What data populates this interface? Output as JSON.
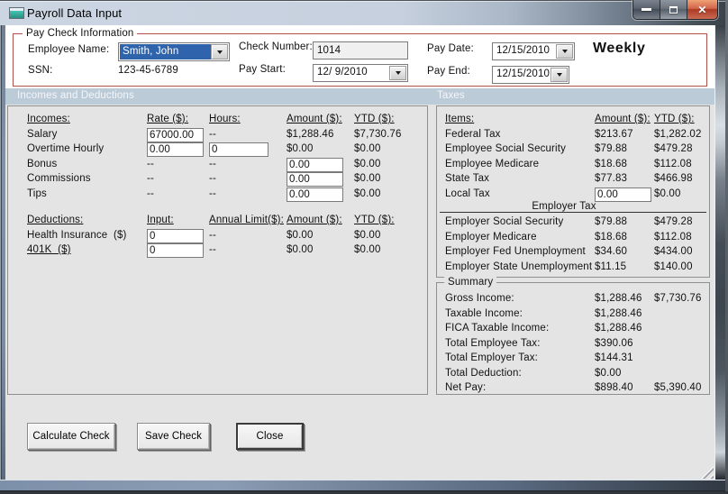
{
  "window": {
    "title": "Payroll Data Input"
  },
  "paycheck": {
    "legend": "Pay Check Information",
    "employee_name": {
      "label": "Employee Name:",
      "value": "Smith, John"
    },
    "ssn": {
      "label": "SSN:",
      "value": "123-45-6789"
    },
    "check_number": {
      "label": "Check Number:",
      "value": "1014"
    },
    "pay_start": {
      "label": "Pay Start:",
      "value": "12/ 9/2010"
    },
    "pay_date": {
      "label": "Pay Date:",
      "value": "12/15/2010"
    },
    "pay_end": {
      "label": "Pay End:",
      "value": "12/15/2010"
    },
    "frequency": "Weekly"
  },
  "section_headers": {
    "left": "Incomes and Deductions",
    "right": "Taxes"
  },
  "incomes": {
    "headers": {
      "item": "Incomes:",
      "rate": "Rate ($):",
      "hours": "Hours:",
      "amount": "Amount ($):",
      "ytd": "YTD ($):"
    },
    "rows": [
      {
        "label": "Salary",
        "rate": "67000.00",
        "hours": "--",
        "amount": "$1,288.46",
        "ytd": "$7,730.76"
      },
      {
        "label": "Overtime Hourly",
        "rate": "0.00",
        "hours": "0",
        "amount": "$0.00",
        "ytd": "$0.00"
      },
      {
        "label": "Bonus",
        "rate": "--",
        "hours": "--",
        "amount": "0.00",
        "ytd": "$0.00"
      },
      {
        "label": "Commissions",
        "rate": "--",
        "hours": "--",
        "amount": "0.00",
        "ytd": "$0.00"
      },
      {
        "label": "Tips",
        "rate": "--",
        "hours": "--",
        "amount": "0.00",
        "ytd": "$0.00"
      }
    ]
  },
  "deductions": {
    "headers": {
      "item": "Deductions:",
      "input": "Input:",
      "annual_limit": "Annual Limit($):",
      "amount": "Amount ($):",
      "ytd": "YTD ($):"
    },
    "rows": [
      {
        "label": "Health Insurance  ($)",
        "input": "0",
        "annual_limit": "--",
        "amount": "$0.00",
        "ytd": "$0.00"
      },
      {
        "label": "401K  ($)",
        "input": "0",
        "annual_limit": "--",
        "amount": "$0.00",
        "ytd": "$0.00"
      }
    ]
  },
  "taxes": {
    "headers": {
      "item": "Items:",
      "amount": "Amount ($):",
      "ytd": "YTD ($):"
    },
    "employee_rows": [
      {
        "label": "Federal Tax",
        "amount": "$213.67",
        "ytd": "$1,282.02"
      },
      {
        "label": "Employee Social Security",
        "amount": "$79.88",
        "ytd": "$479.28"
      },
      {
        "label": "Employee Medicare",
        "amount": "$18.68",
        "ytd": "$112.08"
      },
      {
        "label": "State Tax",
        "amount": "$77.83",
        "ytd": "$466.98"
      },
      {
        "label": "Local Tax",
        "amount": "0.00",
        "ytd": "$0.00"
      }
    ],
    "employer_caption": "Employer Tax",
    "employer_rows": [
      {
        "label": "Employer Social Security",
        "amount": "$79.88",
        "ytd": "$479.28"
      },
      {
        "label": "Employer Medicare",
        "amount": "$18.68",
        "ytd": "$112.08"
      },
      {
        "label": "Employer Fed Unemployment",
        "amount": "$34.60",
        "ytd": "$434.00"
      },
      {
        "label": "Employer State Unemployment",
        "amount": "$11.15",
        "ytd": "$140.00"
      }
    ]
  },
  "summary": {
    "legend": "Summary",
    "rows": [
      {
        "label": "Gross Income:",
        "amount": "$1,288.46",
        "ytd": "$7,730.76"
      },
      {
        "label": "Taxable Income:",
        "amount": "$1,288.46",
        "ytd": ""
      },
      {
        "label": "FICA Taxable Income:",
        "amount": "$1,288.46",
        "ytd": ""
      },
      {
        "label": "Total Employee Tax:",
        "amount": "$390.06",
        "ytd": ""
      },
      {
        "label": "Total Employer Tax:",
        "amount": "$144.31",
        "ytd": ""
      },
      {
        "label": "Total Deduction:",
        "amount": "$0.00",
        "ytd": ""
      },
      {
        "label": "Net Pay:",
        "amount": "$898.40",
        "ytd": "$5,390.40"
      }
    ]
  },
  "actions": {
    "calculate": "Calculate Check",
    "save": "Save Check",
    "close": "Close"
  }
}
